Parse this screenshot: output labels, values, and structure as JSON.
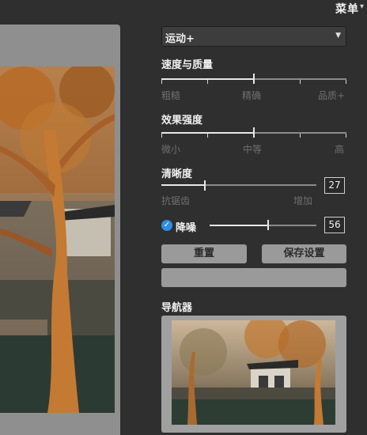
{
  "header": {
    "menu_label": "菜单"
  },
  "mode_select": {
    "selected": "运动+"
  },
  "speed_quality": {
    "title": "速度与质量",
    "left_label": "粗糙",
    "mid_label": "精确",
    "right_label": "品质+",
    "level_percent": 50
  },
  "effect_strength": {
    "title": "效果强度",
    "left_label": "微小",
    "mid_label": "中等",
    "right_label": "高",
    "level_percent": 50
  },
  "sharpness": {
    "title": "清晰度",
    "left_label": "抗锯齿",
    "right_label": "增加",
    "value": "27"
  },
  "denoise": {
    "label": "降噪",
    "checked": true,
    "value": "56"
  },
  "buttons": {
    "reset": "重置",
    "save_settings": "保存设置"
  },
  "navigator": {
    "title": "导航器"
  },
  "colors": {
    "accent": "#2f8de4",
    "panel_bg": "#2f2f2f",
    "button_bg": "#9a9a9a"
  }
}
